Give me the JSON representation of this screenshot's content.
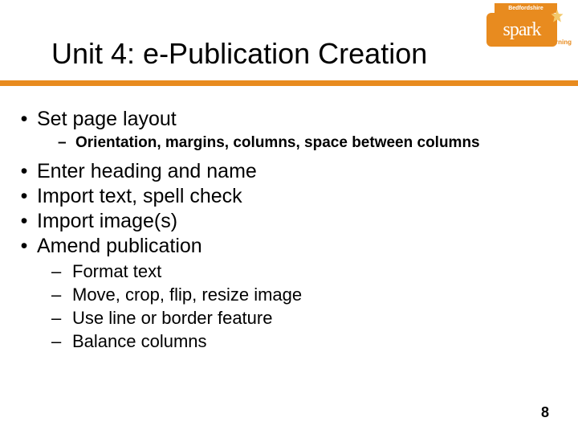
{
  "logo": {
    "bedford": "Bedfordshire",
    "spark": "spark",
    "adult": "adult learning"
  },
  "title": "Unit 4: e-Publication Creation",
  "bullets": {
    "b1": "Set page layout",
    "b1_sub1": "Orientation, margins, columns, space between columns",
    "b2": "Enter heading and name",
    "b3": "Import text, spell check",
    "b4": "Import image(s)",
    "b5": "Amend publication",
    "b5_sub1": "Format text",
    "b5_sub2": "Move, crop, flip, resize image",
    "b5_sub3": "Use line or border feature",
    "b5_sub4": "Balance columns"
  },
  "page_number": "8"
}
